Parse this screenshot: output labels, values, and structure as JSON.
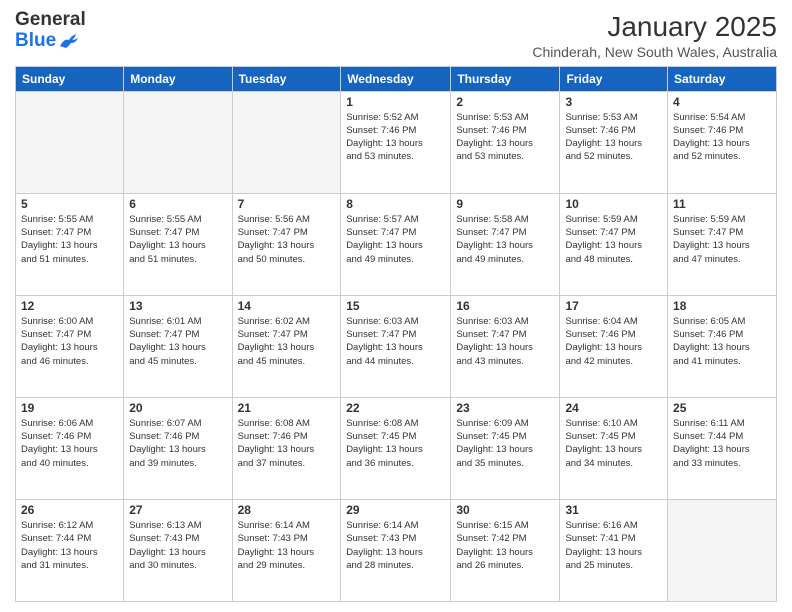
{
  "header": {
    "logo_general": "General",
    "logo_blue": "Blue",
    "title": "January 2025",
    "subtitle": "Chinderah, New South Wales, Australia"
  },
  "days_of_week": [
    "Sunday",
    "Monday",
    "Tuesday",
    "Wednesday",
    "Thursday",
    "Friday",
    "Saturday"
  ],
  "weeks": [
    [
      {
        "day": "",
        "info": ""
      },
      {
        "day": "",
        "info": ""
      },
      {
        "day": "",
        "info": ""
      },
      {
        "day": "1",
        "info": "Sunrise: 5:52 AM\nSunset: 7:46 PM\nDaylight: 13 hours\nand 53 minutes."
      },
      {
        "day": "2",
        "info": "Sunrise: 5:53 AM\nSunset: 7:46 PM\nDaylight: 13 hours\nand 53 minutes."
      },
      {
        "day": "3",
        "info": "Sunrise: 5:53 AM\nSunset: 7:46 PM\nDaylight: 13 hours\nand 52 minutes."
      },
      {
        "day": "4",
        "info": "Sunrise: 5:54 AM\nSunset: 7:46 PM\nDaylight: 13 hours\nand 52 minutes."
      }
    ],
    [
      {
        "day": "5",
        "info": "Sunrise: 5:55 AM\nSunset: 7:47 PM\nDaylight: 13 hours\nand 51 minutes."
      },
      {
        "day": "6",
        "info": "Sunrise: 5:55 AM\nSunset: 7:47 PM\nDaylight: 13 hours\nand 51 minutes."
      },
      {
        "day": "7",
        "info": "Sunrise: 5:56 AM\nSunset: 7:47 PM\nDaylight: 13 hours\nand 50 minutes."
      },
      {
        "day": "8",
        "info": "Sunrise: 5:57 AM\nSunset: 7:47 PM\nDaylight: 13 hours\nand 49 minutes."
      },
      {
        "day": "9",
        "info": "Sunrise: 5:58 AM\nSunset: 7:47 PM\nDaylight: 13 hours\nand 49 minutes."
      },
      {
        "day": "10",
        "info": "Sunrise: 5:59 AM\nSunset: 7:47 PM\nDaylight: 13 hours\nand 48 minutes."
      },
      {
        "day": "11",
        "info": "Sunrise: 5:59 AM\nSunset: 7:47 PM\nDaylight: 13 hours\nand 47 minutes."
      }
    ],
    [
      {
        "day": "12",
        "info": "Sunrise: 6:00 AM\nSunset: 7:47 PM\nDaylight: 13 hours\nand 46 minutes."
      },
      {
        "day": "13",
        "info": "Sunrise: 6:01 AM\nSunset: 7:47 PM\nDaylight: 13 hours\nand 45 minutes."
      },
      {
        "day": "14",
        "info": "Sunrise: 6:02 AM\nSunset: 7:47 PM\nDaylight: 13 hours\nand 45 minutes."
      },
      {
        "day": "15",
        "info": "Sunrise: 6:03 AM\nSunset: 7:47 PM\nDaylight: 13 hours\nand 44 minutes."
      },
      {
        "day": "16",
        "info": "Sunrise: 6:03 AM\nSunset: 7:47 PM\nDaylight: 13 hours\nand 43 minutes."
      },
      {
        "day": "17",
        "info": "Sunrise: 6:04 AM\nSunset: 7:46 PM\nDaylight: 13 hours\nand 42 minutes."
      },
      {
        "day": "18",
        "info": "Sunrise: 6:05 AM\nSunset: 7:46 PM\nDaylight: 13 hours\nand 41 minutes."
      }
    ],
    [
      {
        "day": "19",
        "info": "Sunrise: 6:06 AM\nSunset: 7:46 PM\nDaylight: 13 hours\nand 40 minutes."
      },
      {
        "day": "20",
        "info": "Sunrise: 6:07 AM\nSunset: 7:46 PM\nDaylight: 13 hours\nand 39 minutes."
      },
      {
        "day": "21",
        "info": "Sunrise: 6:08 AM\nSunset: 7:46 PM\nDaylight: 13 hours\nand 37 minutes."
      },
      {
        "day": "22",
        "info": "Sunrise: 6:08 AM\nSunset: 7:45 PM\nDaylight: 13 hours\nand 36 minutes."
      },
      {
        "day": "23",
        "info": "Sunrise: 6:09 AM\nSunset: 7:45 PM\nDaylight: 13 hours\nand 35 minutes."
      },
      {
        "day": "24",
        "info": "Sunrise: 6:10 AM\nSunset: 7:45 PM\nDaylight: 13 hours\nand 34 minutes."
      },
      {
        "day": "25",
        "info": "Sunrise: 6:11 AM\nSunset: 7:44 PM\nDaylight: 13 hours\nand 33 minutes."
      }
    ],
    [
      {
        "day": "26",
        "info": "Sunrise: 6:12 AM\nSunset: 7:44 PM\nDaylight: 13 hours\nand 31 minutes."
      },
      {
        "day": "27",
        "info": "Sunrise: 6:13 AM\nSunset: 7:43 PM\nDaylight: 13 hours\nand 30 minutes."
      },
      {
        "day": "28",
        "info": "Sunrise: 6:14 AM\nSunset: 7:43 PM\nDaylight: 13 hours\nand 29 minutes."
      },
      {
        "day": "29",
        "info": "Sunrise: 6:14 AM\nSunset: 7:43 PM\nDaylight: 13 hours\nand 28 minutes."
      },
      {
        "day": "30",
        "info": "Sunrise: 6:15 AM\nSunset: 7:42 PM\nDaylight: 13 hours\nand 26 minutes."
      },
      {
        "day": "31",
        "info": "Sunrise: 6:16 AM\nSunset: 7:41 PM\nDaylight: 13 hours\nand 25 minutes."
      },
      {
        "day": "",
        "info": ""
      }
    ]
  ]
}
